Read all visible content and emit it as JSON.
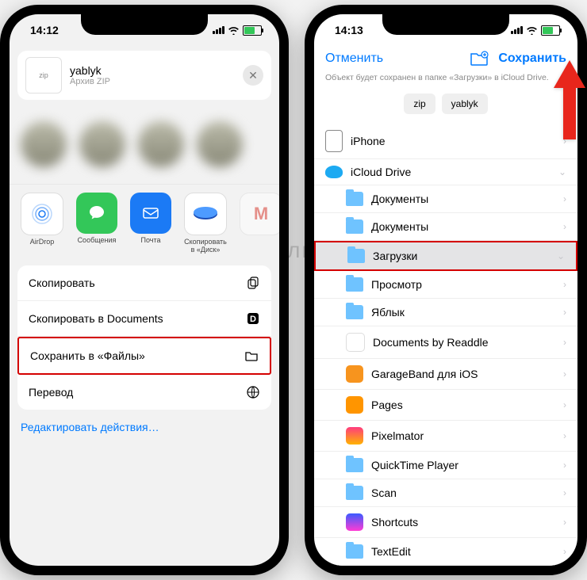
{
  "watermark": "Яблык",
  "phone1": {
    "time": "14:12",
    "share": {
      "zip_badge": "zip",
      "filename": "yablyk",
      "subtitle": "Архив ZIP"
    },
    "apps": {
      "airdrop": "AirDrop",
      "messages": "Сообщения",
      "mail": "Почта",
      "disk": "Скопировать в «Диск»",
      "gmail": "M"
    },
    "actions": {
      "copy": "Скопировать",
      "copy_to_documents": "Скопировать в Documents",
      "save_to_files": "Сохранить в «Файлы»",
      "translate": "Перевод"
    },
    "edit_actions": "Редактировать действия…"
  },
  "phone2": {
    "time": "14:13",
    "nav": {
      "cancel": "Отменить",
      "save": "Сохранить"
    },
    "hint": "Объект будет сохранен в папке «Загрузки» в iCloud Drive.",
    "chips": {
      "zip": "zip",
      "name": "yablyk"
    },
    "locations": {
      "iphone": "iPhone",
      "icloud": "iCloud Drive"
    },
    "folders": {
      "documents1": "Документы",
      "documents2": "Документы",
      "downloads": "Загрузки",
      "preview": "Просмотр",
      "yablyk": "Яблык",
      "documents_readdle": "Documents by Readdle",
      "garageband": "GarageBand для iOS",
      "pages": "Pages",
      "pixelmator": "Pixelmator",
      "quicktime": "QuickTime Player",
      "scan": "Scan",
      "shortcuts": "Shortcuts",
      "textedit": "TextEdit"
    }
  }
}
